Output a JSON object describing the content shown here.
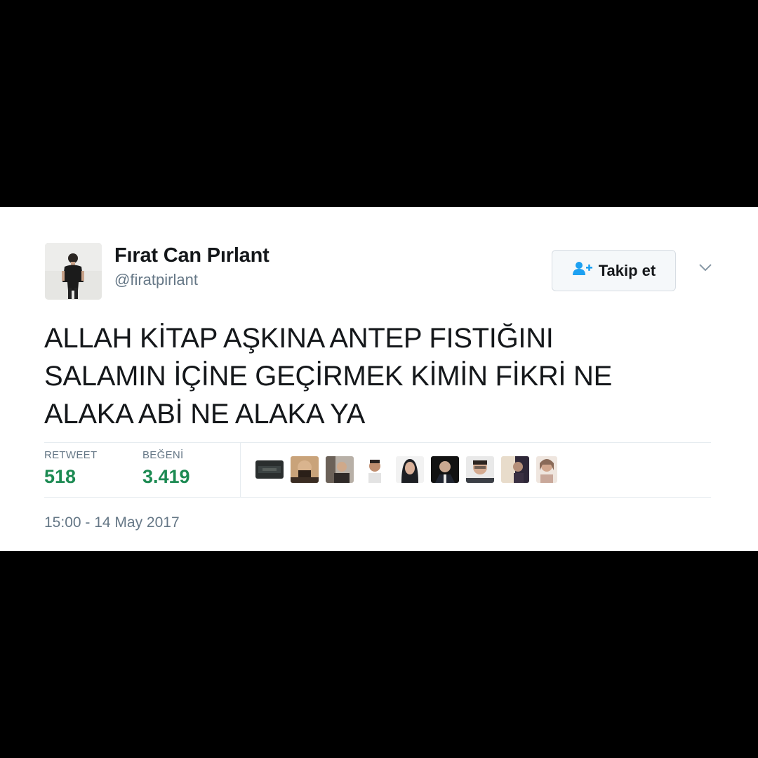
{
  "tweet": {
    "display_name": "Fırat Can Pırlant",
    "handle": "@firatpirlant",
    "follow_label": "Takip et",
    "text_lines": [
      "ALLAH KİTAP AŞKINA ANTEP FISTIĞINI",
      "SALAMIN İÇİNE GEÇİRMEK KİMİN FİKRİ NE",
      "ALAKA ABİ NE ALAKA YA"
    ],
    "stats": {
      "retweet_label": "RETWEET",
      "retweet_count": "518",
      "like_label": "BEĞENİ",
      "like_count": "3.419"
    },
    "liker_avatar_count": 9,
    "timestamp": "15:00 - 14 May 2017"
  },
  "icons": {
    "follow": "add-user-icon",
    "more": "chevron-down-icon"
  },
  "colors": {
    "background": "#000000",
    "card": "#ffffff",
    "stat_number": "#1c8a52",
    "follow_icon": "#1da1f2",
    "secondary_text": "#657786"
  }
}
